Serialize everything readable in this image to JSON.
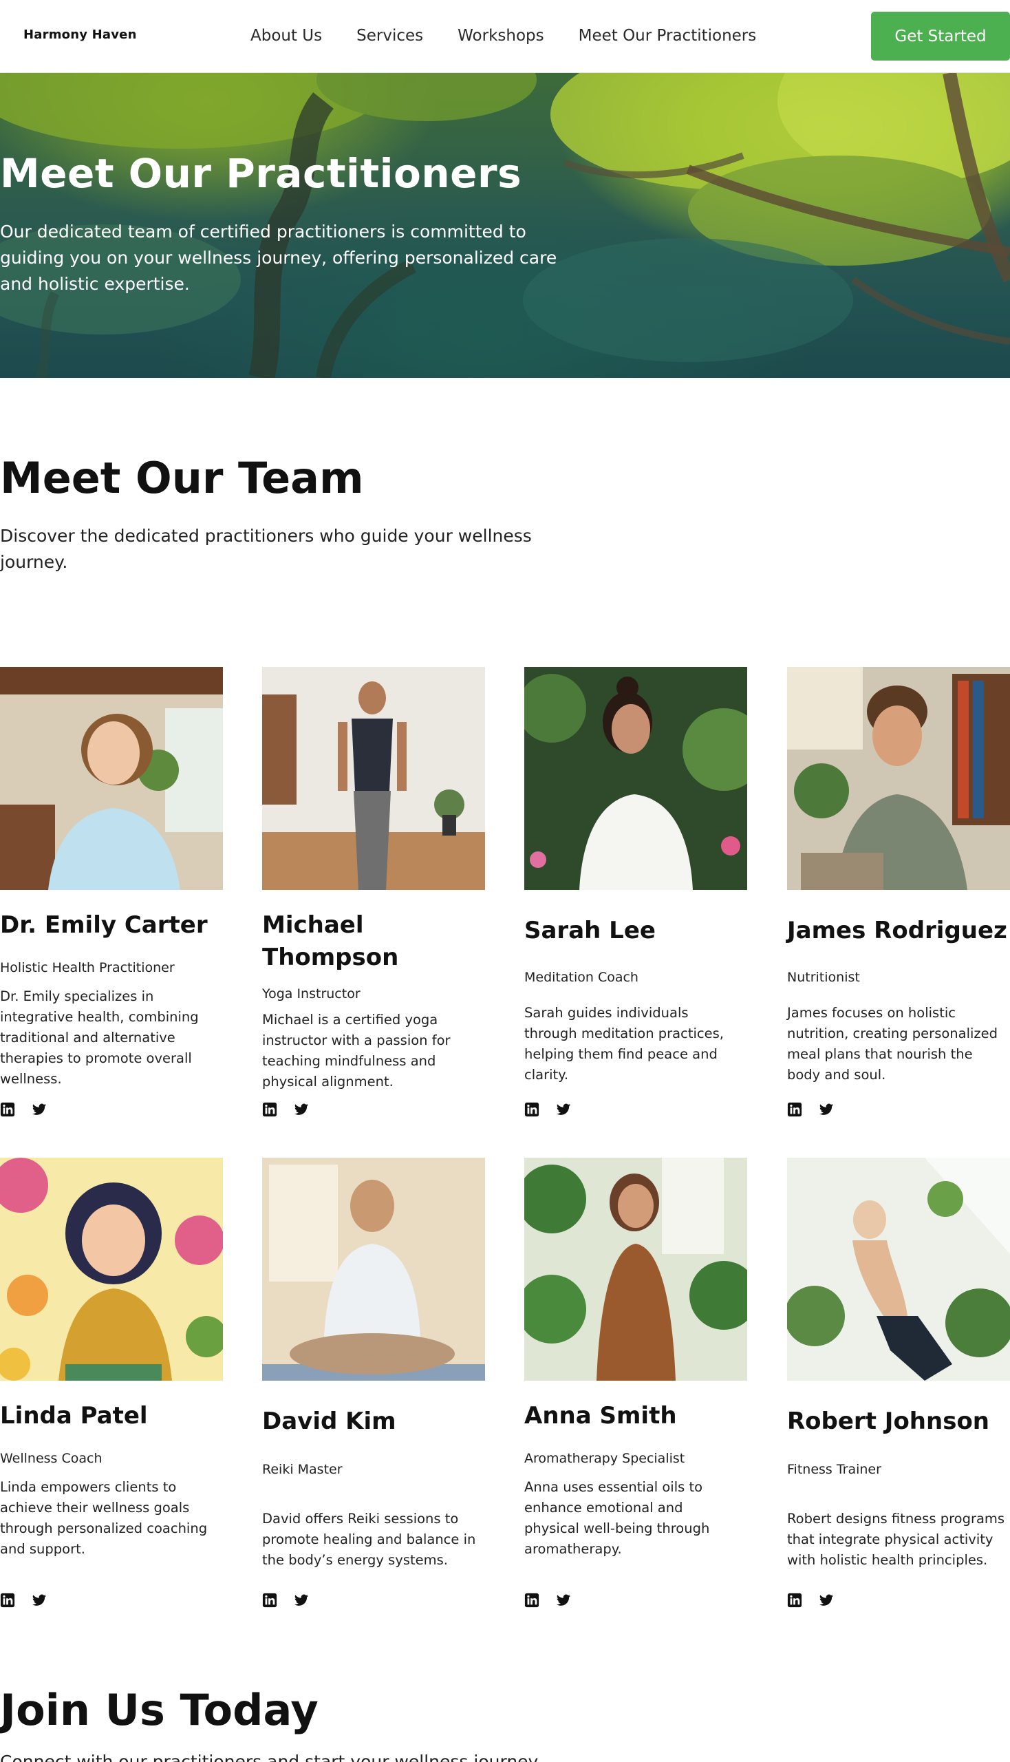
{
  "nav": {
    "logo": "Harmony Haven",
    "links": [
      "About Us",
      "Services",
      "Workshops",
      "Meet Our Practitioners"
    ],
    "cta": "Get Started"
  },
  "hero": {
    "title": "Meet Our Practitioners",
    "text": "Our dedicated team of certified practitioners is committed to guiding you on your wellness journey, offering personalized care and holistic expertise."
  },
  "team": {
    "title": "Meet Our Team",
    "subtitle": "Discover the dedicated practitioners who guide your wellness journey.",
    "members": [
      {
        "name": "Dr. Emily Carter",
        "role": "Holistic Health Practitioner",
        "bio": "Dr. Emily specializes in integrative health, combining traditional and alternative therapies to promote overall wellness."
      },
      {
        "name": "Michael Thompson",
        "role": "Yoga Instructor",
        "bio": "Michael is a certified yoga instructor with a passion for teaching mindfulness and physical alignment."
      },
      {
        "name": "Sarah Lee",
        "role": "Meditation Coach",
        "bio": "Sarah guides individuals through meditation practices, helping them find peace and clarity."
      },
      {
        "name": "James Rodriguez",
        "role": "Nutritionist",
        "bio": "James focuses on holistic nutrition, creating personalized meal plans that nourish the body and soul."
      },
      {
        "name": "Linda Patel",
        "role": "Wellness Coach",
        "bio": "Linda empowers clients to achieve their wellness goals through personalized coaching and support."
      },
      {
        "name": "David Kim",
        "role": "Reiki Master",
        "bio": "David offers Reiki sessions to promote healing and balance in the body’s energy systems."
      },
      {
        "name": "Anna Smith",
        "role": "Aromatherapy Specialist",
        "bio": "Anna uses essential oils to enhance emotional and physical well-being through aromatherapy."
      },
      {
        "name": "Robert Johnson",
        "role": "Fitness Trainer",
        "bio": "Robert designs fitness programs that integrate physical activity with holistic health principles."
      }
    ]
  },
  "join": {
    "title": "Join Us Today",
    "subtitle": "Connect with our practitioners and start your wellness journey"
  },
  "icons": {
    "social": [
      "linkedin-icon",
      "twitter-icon"
    ]
  },
  "colors": {
    "accent": "#4caf50"
  }
}
